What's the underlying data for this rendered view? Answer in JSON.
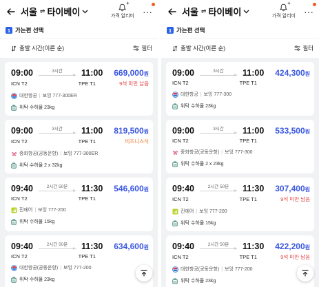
{
  "header": {
    "origin": "서울",
    "arrows": "⇌",
    "destination": "타이베이",
    "price_alert_label": "가격 알리미",
    "more": "···"
  },
  "step": {
    "number": "1",
    "label": "가는편 선택"
  },
  "sortbar": {
    "sort_label": "출발 시간(이른 순)",
    "filter_label": "필터"
  },
  "colors": {
    "price": "#3a57e0",
    "accent": "#2a62e8",
    "seat_warning": "#e03a3a",
    "business": "#e8762a",
    "dot": "#f25a1d"
  },
  "panes": [
    {
      "flights": [
        {
          "dep_time": "09:00",
          "duration": "3시간",
          "arr_time": "11:00",
          "price": "669,000",
          "won": "원",
          "dep_code": "ICN T2",
          "arr_code": "TPE T1",
          "note": "9석 미만 남음",
          "note_type": "red",
          "airline": "대한항공",
          "logo": "korean-air-logo",
          "aircraft": "보잉 777-300ER",
          "baggage": "위탁 수하물 23kg"
        },
        {
          "dep_time": "09:00",
          "duration": "3시간",
          "arr_time": "11:00",
          "price": "819,500",
          "won": "원",
          "dep_code": "ICN T2",
          "arr_code": "TPE T1",
          "note": "비즈니스석",
          "note_type": "orange",
          "airline": "중화항공(공동운항)",
          "logo": "china-airlines-logo",
          "aircraft": "보잉 777-300ER",
          "baggage": "위탁 수하물 2 x 32kg"
        },
        {
          "dep_time": "09:40",
          "duration": "2시간 50분",
          "arr_time": "11:30",
          "price": "546,600",
          "won": "원",
          "dep_code": "ICN T2",
          "arr_code": "TPE T1",
          "note": "",
          "note_type": "",
          "airline": "진에어",
          "logo": "jinair-logo",
          "aircraft": "보잉 777-200",
          "baggage": "위탁 수하물 15kg"
        },
        {
          "dep_time": "09:40",
          "duration": "2시간 50분",
          "arr_time": "11:30",
          "price": "634,600",
          "won": "원",
          "dep_code": "ICN T2",
          "arr_code": "TPE T1",
          "note": "",
          "note_type": "",
          "airline": "대한항공(공동운항)",
          "logo": "korean-air-logo",
          "aircraft": "보잉 777-200",
          "baggage": "위탁 수하물 23kg"
        }
      ]
    },
    {
      "flights": [
        {
          "dep_time": "09:00",
          "duration": "3시간",
          "arr_time": "11:00",
          "price": "424,300",
          "won": "원",
          "dep_code": "ICN T2",
          "arr_code": "TPE T1",
          "note": "",
          "note_type": "",
          "airline": "대한항공",
          "logo": "korean-air-logo",
          "aircraft": "보잉 777-300",
          "baggage": "위탁 수하물 23kg"
        },
        {
          "dep_time": "09:00",
          "duration": "3시간",
          "arr_time": "11:00",
          "price": "533,500",
          "won": "원",
          "dep_code": "ICN T2",
          "arr_code": "TPE T1",
          "note": "",
          "note_type": "",
          "airline": "중화항공(공동운항)",
          "logo": "china-airlines-logo",
          "aircraft": "보잉 777-300",
          "baggage": "위탁 수하물 2 x 23kg"
        },
        {
          "dep_time": "09:40",
          "duration": "2시간 50분",
          "arr_time": "11:30",
          "price": "307,400",
          "won": "원",
          "dep_code": "ICN T2",
          "arr_code": "TPE T1",
          "note": "9석 미만 남음",
          "note_type": "red",
          "airline": "진에어",
          "logo": "jinair-logo",
          "aircraft": "보잉 777-200",
          "baggage": "위탁 수하물 15kg"
        },
        {
          "dep_time": "09:40",
          "duration": "2시간 50분",
          "arr_time": "11:30",
          "price": "422,200",
          "won": "원",
          "dep_code": "ICN T2",
          "arr_code": "TPE T1",
          "note": "9석 미만 남음",
          "note_type": "red",
          "airline": "대한항공(공동운항)",
          "logo": "korean-air-logo",
          "aircraft": "보잉 777-200",
          "baggage": "위탁 수하물 23kg"
        }
      ]
    }
  ]
}
